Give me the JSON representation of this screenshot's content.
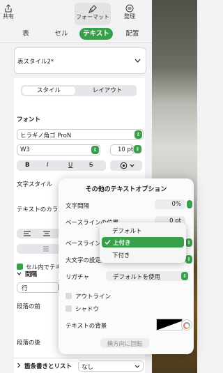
{
  "toolbar": {
    "share_label": "共有",
    "format_label": "フォーマット",
    "organize_label": "整理"
  },
  "tabs": [
    {
      "label": "表"
    },
    {
      "label": "セル"
    },
    {
      "label": "テキスト"
    },
    {
      "label": "配置"
    }
  ],
  "table_style": {
    "value": "表スタイル2*"
  },
  "style_segment": {
    "style": "スタイル",
    "layout": "レイアウト"
  },
  "font": {
    "heading": "フォント",
    "family": "ヒラギノ角ゴ ProN",
    "weight": "W3",
    "size": "10 pt",
    "bold": "B",
    "italic": "I",
    "underline": "U",
    "strike": "S"
  },
  "text_style_label": "文字スタイル",
  "text_color_label": "テキストのカラー",
  "wrap_text_label": "セル内でテキストを折り返す",
  "spacing": {
    "heading": "間隔",
    "row_label": "行",
    "before_label": "段落の前",
    "after_label": "段落の後"
  },
  "bullets": {
    "label": "箇条書きとリスト",
    "value": "なし"
  },
  "popover": {
    "title": "その他のテキストオプション",
    "char_spacing_label": "文字間隔",
    "char_spacing_value": "0%",
    "baseline_shift_label": "ベースラインの位置",
    "baseline_shift_value": "0 pt",
    "baseline_label": "ベースライン",
    "caps_label": "大文字の設定",
    "ligature_label": "リガチャ",
    "ligature_value": "デフォルトを使用",
    "outline_label": "アウトライン",
    "shadow_label": "シャドウ",
    "background_label": "テキストの背景",
    "rotate_button": "横方向に回転"
  },
  "baseline_menu": {
    "items": [
      "デフォルト",
      "上付き",
      "下付き"
    ],
    "selected": 1
  },
  "colors": {
    "accent": "#38a04a"
  }
}
